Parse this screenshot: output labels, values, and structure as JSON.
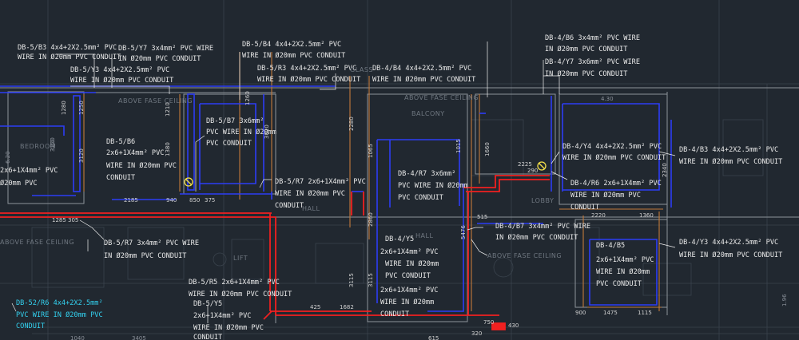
{
  "notes": {
    "db5_b3_l1": "DB-5/B3  4x4+2X2.5mm² PVC",
    "db5_b3_l2": "WIRE IN Ø20mm PVC CONDUIT",
    "db5_y7_l1": "DB-5/Y7   3x4mm² PVC WIRE",
    "db5_y7_l2": "IN Ø20mm PVC CONDUIT",
    "db5_y3_l1": "DB-5/Y3   4x4+2X2.5mm² PVC",
    "db5_y3_l2": "WIRE IN Ø20mm PVC CONDUIT",
    "db5_b4_l1": "DB-5/B4  4x4+2X2.5mm² PVC",
    "db5_b4_l2": "WIRE IN Ø20mm PVC CONDUIT",
    "db5_r3_l1": "DB-5/R3   4x4+2X2.5mm² PVC",
    "db5_r3_l2": "WIRE IN Ø20mm PVC CONDUIT",
    "db4_b4_l1": "DB-4/B4  4x4+2X2.5mm² PVC",
    "db4_b4_l2": "WIRE IN Ø20mm PVC CONDUIT",
    "db4_b6_l1": "DB-4/B6  3x4mm² PVC WIRE",
    "db4_b6_l2": "IN Ø20mm PVC CONDUIT",
    "db4_y7_l1": "DB-4/Y7  3x6mm² PVC WIRE",
    "db4_y7_l2": "IN Ø20mm PVC CONDUIT",
    "db5_b7_l1": "DB-5/B7  3x6mm²",
    "db5_b7_l2": "PVC WIRE IN Ø20mm",
    "db5_b7_l3": "PVC CONDUIT",
    "db5_b6_l1": "DB-5/B6",
    "db5_b6_l2": "2x6+1X4mm² PVC",
    "db5_b6_l3": "WIRE IN Ø20mm PVC",
    "db5_b6_l4": "CONDUIT",
    "db5_r7_l1": "DB-5/R7  2x6+1X4mm² PVC",
    "db5_r7_l2": "WIRE IN Ø20mm PVC",
    "db5_r7_l3": "CONDUIT",
    "db4_r7_l1": "DB-4/R7  3x6mm²",
    "db4_r7_l2": "PVC WIRE IN Ø20mm",
    "db4_r7_l3": "PVC CONDUIT",
    "db4_y4_l1": "DB-4/Y4  4x4+2X2.5mm² PVC",
    "db4_y4_l2": "WIRE IN Ø20mm PVC CONDUIT",
    "db4_b3_l1": "DB-4/B3  4x4+2X2.5mm² PVC",
    "db4_b3_l2": "WIRE IN Ø20mm PVC CONDUIT",
    "db4_r6_l1": "DB-4/R6  2x6+1X4mm² PVC",
    "db4_r6_l2": "WIRE IN Ø20mm PVC",
    "db4_r6_l3": "CONDUIT",
    "left_frag_l1": "2x6+1X4mm² PVC",
    "left_frag_l2": "Ø20mm PVC",
    "db5_r7b_l1": "DB-5/R7  3x4mm² PVC WIRE",
    "db5_r7b_l2": "IN Ø20mm PVC CONDUIT",
    "db4_b7_l1": "DB-4/B7  3x4mm² PVC WIRE",
    "db4_b7_l2": "IN Ø20mm PVC CONDUIT",
    "db4_y5_l1": "DB-4/Y5",
    "db4_y5_l2": "2x6+1X4mm² PVC",
    "db4_y5_l3": "WIRE IN Ø20mm",
    "db4_y5_l4": "PVC CONDUIT",
    "db4_y5_l5": "2x6+1X4mm² PVC",
    "db4_y5_l6": "WIRE IN Ø20mm",
    "db4_y5_l7": "CONDUIT",
    "db4_b5_l1": "DB-4/B5",
    "db4_b5_l2": "2x6+1X4mm² PVC",
    "db4_b5_l3": "WIRE IN Ø20mm",
    "db4_b5_l4": "PVC CONDUIT",
    "db4_y3_l1": "DB-4/Y3  4x4+2X2.5mm² PVC",
    "db4_y3_l2": "WIRE IN Ø20mm PVC CONDUIT",
    "db5_r5_l1": "DB-5/R5  2x6+1X4mm² PVC",
    "db5_r5_l2": "WIRE IN Ø20mm PVC CONDUIT",
    "db5_y5_l1": "DB-5/Y5",
    "db5_y5_l2": "2x6+1X4mm² PVC",
    "db5_y5_l3": "WIRE IN Ø20mm PVC",
    "db5_y5_l4": "CONDUIT",
    "db52_r6_l1": "DB-52/R6  4x4+2X2.5mm²",
    "db52_r6_l2": "PVC WIRE IN Ø20mm PVC",
    "db52_r6_l3": "CONDUIT"
  },
  "rooms": {
    "above_false_ceiling": "ABOVE FASE CEILING",
    "above_false_ceiling_2": "ABOVE FASE CEILING",
    "above_false_ceiling_3": "ABOVE FASE CEILING",
    "above_false_ceiling_4": "ABOVE FASE CEILING",
    "balcony": "BALCONY",
    "bedroom": "BEDROOM",
    "hall": "HALL",
    "hall_2": "HALL",
    "lobby": "LOBBY",
    "lift": "LIFT",
    "glass": "GLASS"
  },
  "dims": {
    "d1280": "1280",
    "d1250": "1250",
    "d1210": "1210",
    "d3120": "3120",
    "d3120b": "3120",
    "d1380": "1380",
    "d2185": "2185",
    "d940": "940",
    "d850": "850",
    "d375": "375",
    "d1285": "1285",
    "d305": "305",
    "d3010": "3010",
    "d2280": "2280",
    "d1260": "1260",
    "d1065": "1065",
    "d2860": "2860",
    "d3115": "3115",
    "d3115b": "3115",
    "d1015": "1015",
    "d1660": "1660",
    "d515": "515",
    "d5476": "5476",
    "d2220": "2220",
    "d1360": "1360",
    "d2225": "2225",
    "d290": "290",
    "d2340": "2340",
    "d900": "900",
    "d1475": "1475",
    "d1115": "1115",
    "d750": "750",
    "d425": "425",
    "d1682": "1682",
    "d1040": "1040",
    "d3405": "3405",
    "d615": "615",
    "d430": "430",
    "d320": "320",
    "d4_30": "4.30",
    "d6_20": "6.20",
    "d3_20": "3.20",
    "d1_96": "1.96"
  }
}
